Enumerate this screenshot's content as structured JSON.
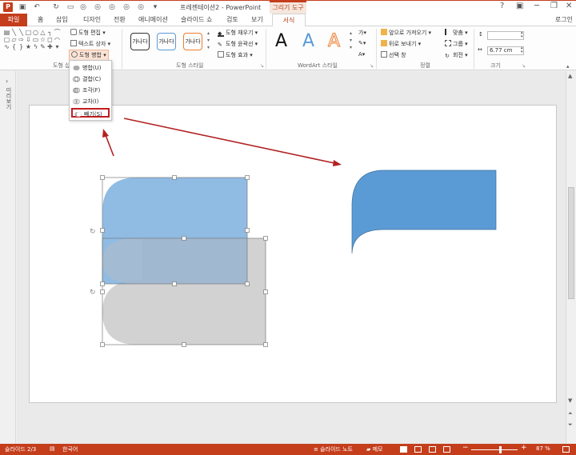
{
  "window": {
    "app_icon": "P",
    "title": "프레젠테이션2 - PowerPoint",
    "context_group": "그리기 도구",
    "help": "?",
    "minimize": "─",
    "restore": "❐",
    "close": "✕"
  },
  "tabs": {
    "file": "파일",
    "home": "홈",
    "insert": "삽입",
    "design": "디자인",
    "transitions": "전환",
    "animations": "애니메이션",
    "slideshow": "슬라이드 쇼",
    "review": "검토",
    "view": "보기",
    "format": "서식",
    "login": "로그인"
  },
  "ribbon": {
    "insert_shapes": {
      "edit_shape": "도형 편집",
      "text_box": "텍스트 상자",
      "merge_shapes": "도형 병합",
      "label": "도형 삽입"
    },
    "shape_styles": {
      "sample": "가나다",
      "fill": "도형 채우기",
      "outline": "도형 윤곽선",
      "effects": "도형 효과",
      "label": "도형 스타일"
    },
    "wordart": {
      "letter": "A",
      "label": "WordArt 스타일"
    },
    "arrange": {
      "bring_forward": "앞으로 가져오기",
      "send_backward": "뒤로 보내기",
      "selection_pane": "선택 창",
      "align": "맞춤",
      "group": "그룹",
      "rotate": "회전",
      "label": "정렬"
    },
    "size": {
      "height": "",
      "width": "6.77 cm",
      "label": "크기"
    }
  },
  "merge_menu": {
    "union": "병합(U)",
    "combine": "결합(C)",
    "fragment": "조각(F)",
    "intersect": "교차(I)",
    "subtract": "빼기(S)"
  },
  "left_panel": {
    "label": "미리보기"
  },
  "statusbar": {
    "slide": "슬라이드 2/3",
    "language": "한국어",
    "notes": "슬라이드 노트",
    "comments": "메모",
    "zoom": "87 %",
    "zoom_minus": "−",
    "zoom_plus": "+"
  },
  "colors": {
    "accent": "#c43e1c",
    "shape_blue": "#5b9bd5",
    "shape_gray": "#d0d0d0",
    "arrow_red": "#b22222"
  }
}
